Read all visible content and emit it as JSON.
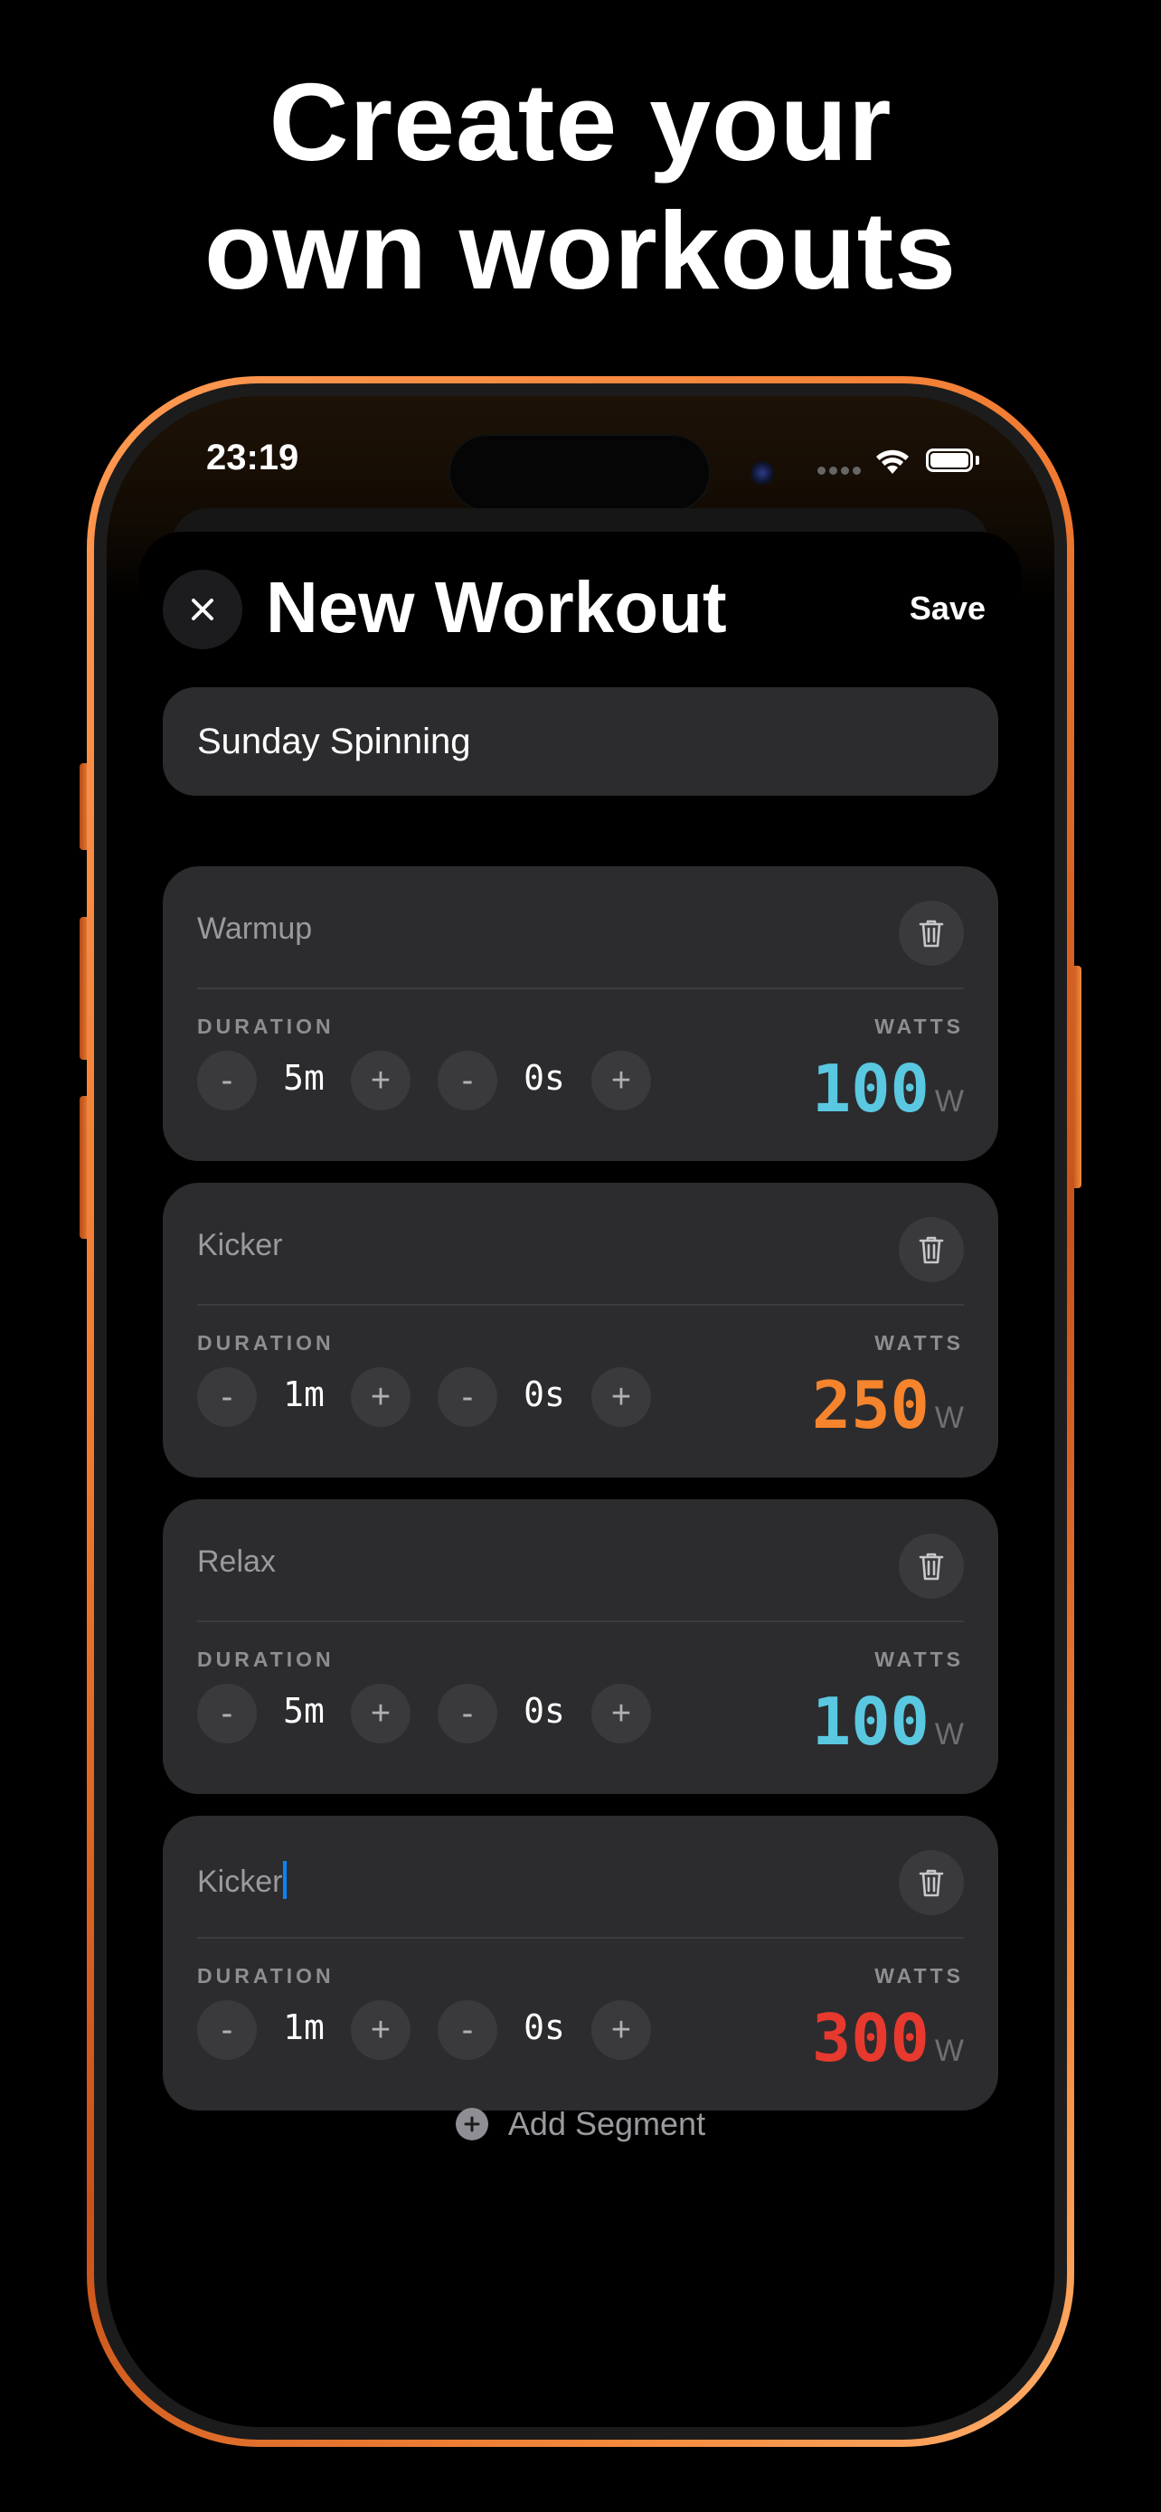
{
  "headline": {
    "line1": "Create your",
    "line2": "own workouts"
  },
  "status_bar": {
    "time": "23:19"
  },
  "nav": {
    "title": "New Workout",
    "save_label": "Save"
  },
  "workout_name": "Sunday Spinning",
  "labels": {
    "duration": "DURATION",
    "watts": "WATTS",
    "watts_unit": "W",
    "minus": "-",
    "plus": "+"
  },
  "segments": [
    {
      "name": "Warmup",
      "minutes": "5m",
      "seconds": "0s",
      "watts": "100",
      "color": "#5ac8e0"
    },
    {
      "name": "Kicker",
      "minutes": "1m",
      "seconds": "0s",
      "watts": "250",
      "color": "#f5842c"
    },
    {
      "name": "Relax",
      "minutes": "5m",
      "seconds": "0s",
      "watts": "100",
      "color": "#5ac8e0"
    },
    {
      "name": "Kicker",
      "minutes": "1m",
      "seconds": "0s",
      "watts": "300",
      "color": "#e8392f"
    }
  ],
  "add_segment_label": "Add Segment"
}
